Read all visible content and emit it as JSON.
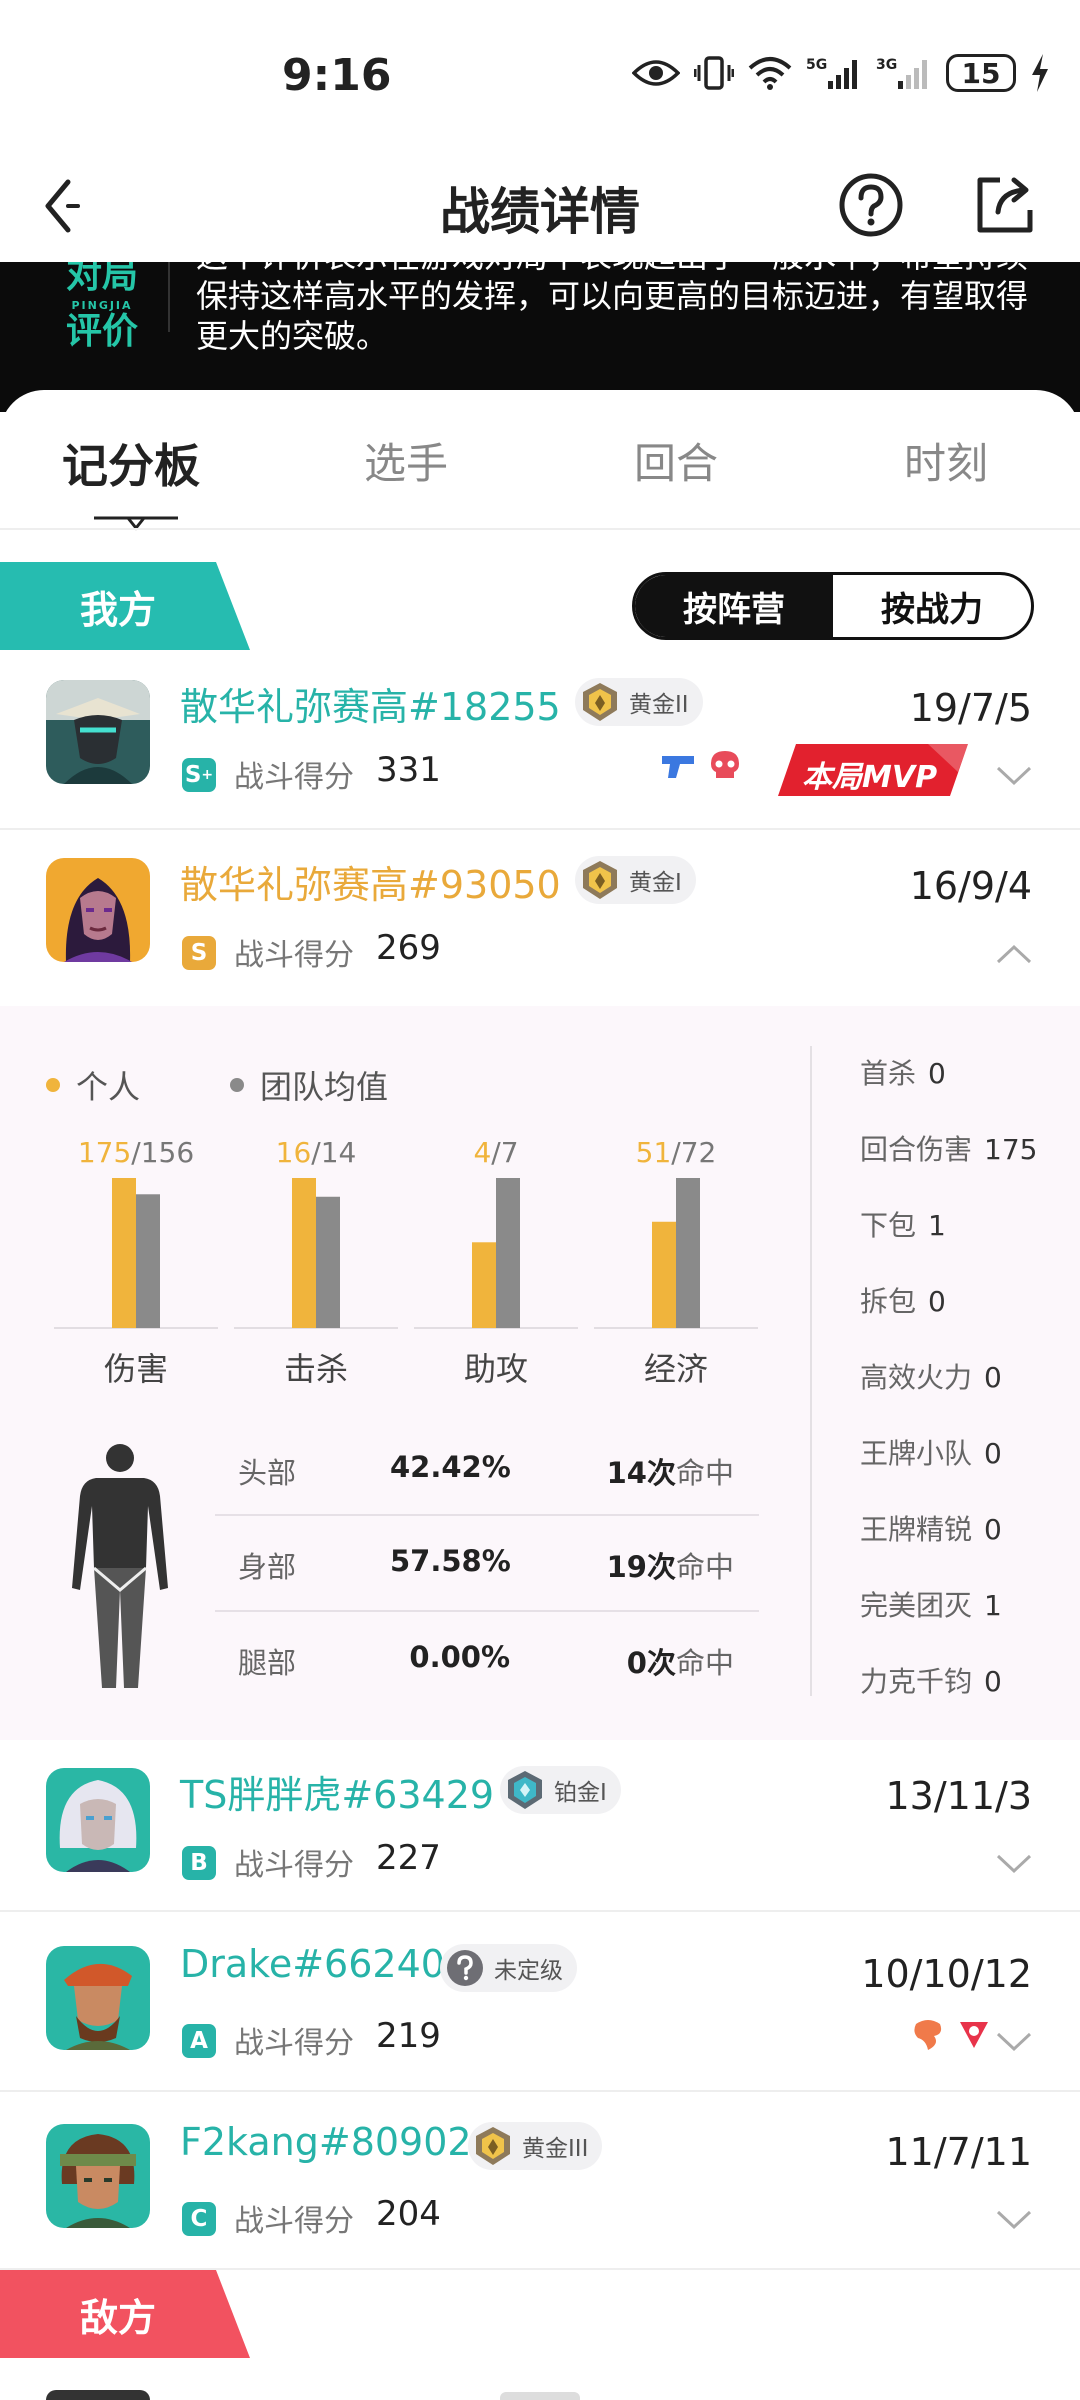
{
  "status_bar": {
    "time": "9:16",
    "battery": "15",
    "network_a": "5G",
    "network_b": "3G"
  },
  "nav": {
    "title": "战绩详情"
  },
  "banner": {
    "logo_line1": "对局",
    "logo_pinyin": "PINGJIA",
    "logo_line2": "评价",
    "text": "这个评价表示在游戏对局中表现超出了一般水平，希望持续保持这样高水平的发挥，可以向更高的目标迈进，有望取得更大的突破。"
  },
  "tabs": [
    {
      "label": "记分板"
    },
    {
      "label": "选手"
    },
    {
      "label": "回合"
    },
    {
      "label": "时刻"
    }
  ],
  "team_labels": {
    "ours": "我方",
    "enemy": "敌方"
  },
  "toggle": {
    "by_camp": "按阵营",
    "by_power": "按战力"
  },
  "score_label": "战斗得分",
  "players": [
    {
      "name": "散华礼弥赛高#18255",
      "name_color": "#27b3a8",
      "rank": "黄金II",
      "grade": "S",
      "grade_sup": "+",
      "grade_color": "#27b3a8",
      "score": "331",
      "kda": "19/7/5",
      "mvp": "本局MVP",
      "expanded": false
    },
    {
      "name": "散华礼弥赛高#93050",
      "name_color": "#e9a93a",
      "rank": "黄金I",
      "grade": "S",
      "grade_sup": "",
      "grade_color": "#e9a93a",
      "score": "269",
      "kda": "16/9/4",
      "expanded": true
    },
    {
      "name": "TS胖胖虎#63429",
      "name_color": "#27b3a8",
      "rank": "铂金I",
      "grade": "B",
      "grade_sup": "",
      "grade_color": "#27b3a8",
      "score": "227",
      "kda": "13/11/3",
      "expanded": false
    },
    {
      "name": "Drake#66240",
      "name_color": "#27b3a8",
      "rank": "未定级",
      "grade": "A",
      "grade_sup": "",
      "grade_color": "#27b3a8",
      "score": "219",
      "kda": "10/10/12",
      "expanded": false
    },
    {
      "name": "F2kang#80902",
      "name_color": "#27b3a8",
      "rank": "黄金III",
      "grade": "C",
      "grade_sup": "",
      "grade_color": "#27b3a8",
      "score": "204",
      "kda": "11/7/11",
      "expanded": false
    }
  ],
  "detail": {
    "legend_personal": "个人",
    "legend_team": "团队均值",
    "colors": {
      "personal": "#f0b43c",
      "team": "#8a8a8a"
    },
    "chart_data": {
      "type": "bar",
      "categories": [
        "伤害",
        "击杀",
        "助攻",
        "经济"
      ],
      "series": [
        {
          "name": "个人",
          "values": [
            175,
            16,
            4,
            51
          ]
        },
        {
          "name": "团队均值",
          "values": [
            156,
            14,
            7,
            72
          ]
        }
      ],
      "labels": [
        {
          "a": "175",
          "b": "/156"
        },
        {
          "a": "16",
          "b": "/14"
        },
        {
          "a": "4",
          "b": "/7"
        },
        {
          "a": "51",
          "b": "/72"
        }
      ]
    },
    "hit": [
      {
        "part": "头部",
        "pct": "42.42%",
        "count": "14次",
        "unit": "命中"
      },
      {
        "part": "身部",
        "pct": "57.58%",
        "count": "19次",
        "unit": "命中"
      },
      {
        "part": "腿部",
        "pct": "0.00%",
        "count": "0次",
        "unit": "命中"
      }
    ],
    "stats": [
      {
        "label": "首杀",
        "value": "0"
      },
      {
        "label": "回合伤害",
        "value": "175"
      },
      {
        "label": "下包",
        "value": "1"
      },
      {
        "label": "拆包",
        "value": "0"
      },
      {
        "label": "高效火力",
        "value": "0"
      },
      {
        "label": "王牌小队",
        "value": "0"
      },
      {
        "label": "王牌精锐",
        "value": "0"
      },
      {
        "label": "完美团灭",
        "value": "1"
      },
      {
        "label": "力克千钧",
        "value": "0"
      }
    ]
  }
}
